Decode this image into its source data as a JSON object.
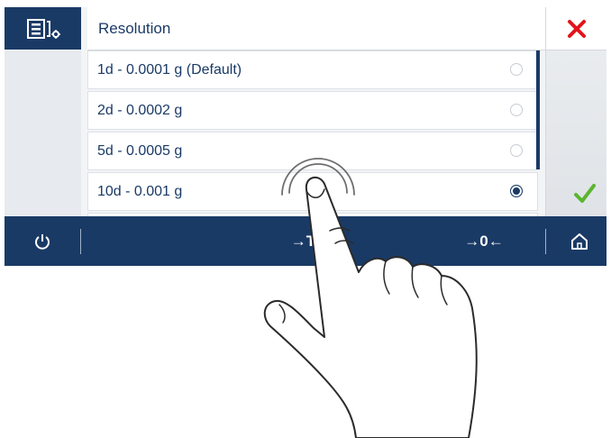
{
  "header": {
    "title": "Resolution",
    "settings_icon": "settings-list-icon",
    "close_icon": "close-icon"
  },
  "options": [
    {
      "label": "1d - 0.0001 g (Default)",
      "selected": false
    },
    {
      "label": "2d - 0.0002 g",
      "selected": false
    },
    {
      "label": "5d - 0.0005 g",
      "selected": false
    },
    {
      "label": "10d - 0.001 g",
      "selected": true
    }
  ],
  "footer": {
    "power_icon": "power-icon",
    "tare_label": "→T←",
    "zero_label": "→0←",
    "home_icon": "home-icon"
  },
  "colors": {
    "brand": "#1a3a66",
    "cancel": "#e3141b",
    "ok": "#5bb531"
  }
}
